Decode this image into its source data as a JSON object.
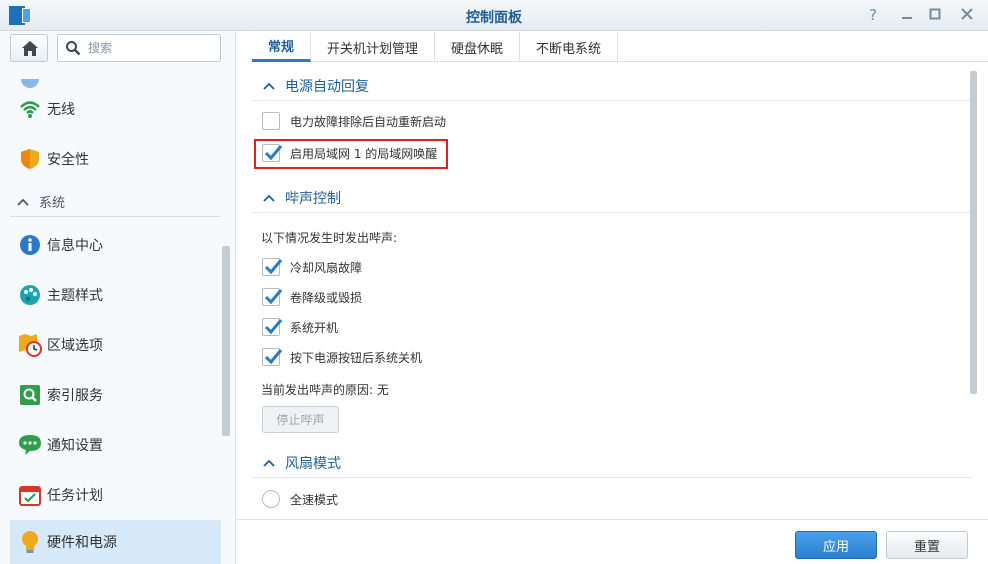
{
  "window": {
    "title": "控制面板"
  },
  "search": {
    "placeholder": "搜索"
  },
  "sidebar": {
    "items": [
      {
        "label": "无线",
        "icon": "wifi-icon"
      },
      {
        "label": "安全性",
        "icon": "shield-icon"
      },
      {
        "label": "信息中心",
        "icon": "info-icon"
      },
      {
        "label": "主题样式",
        "icon": "palette-icon"
      },
      {
        "label": "区域选项",
        "icon": "clock-map-icon"
      },
      {
        "label": "索引服务",
        "icon": "index-search-icon"
      },
      {
        "label": "通知设置",
        "icon": "chat-icon"
      },
      {
        "label": "任务计划",
        "icon": "calendar-icon"
      },
      {
        "label": "硬件和电源",
        "icon": "bulb-icon",
        "active": true
      }
    ],
    "group_system": "系统"
  },
  "tabs": [
    {
      "label": "常规",
      "active": true
    },
    {
      "label": "开关机计划管理"
    },
    {
      "label": "硬盘休眠"
    },
    {
      "label": "不断电系统"
    }
  ],
  "power_recovery": {
    "title": "电源自动回复",
    "restart_after_power_failure": {
      "label": "电力故障排除后自动重新启动",
      "checked": false
    },
    "wake_on_lan": {
      "label": "启用局域网 1 的局域网唤醒",
      "checked": true
    }
  },
  "beep_control": {
    "title": "哔声控制",
    "intro": "以下情况发生时发出哔声:",
    "options": [
      {
        "label": "冷却风扇故障",
        "checked": true
      },
      {
        "label": "卷降级或毁损",
        "checked": true
      },
      {
        "label": "系统开机",
        "checked": true
      },
      {
        "label": "按下电源按钮后系统关机",
        "checked": true
      }
    ],
    "current_reason": "当前发出哔声的原因: 无",
    "stop_button": "停止哔声"
  },
  "fan_mode": {
    "title": "风扇模式",
    "option_full_speed": "全速模式"
  },
  "footer": {
    "apply": "应用",
    "reset": "重置"
  },
  "colors": {
    "accent": "#2a80d2",
    "title": "#1f5f99",
    "highlight": "#e32020"
  }
}
